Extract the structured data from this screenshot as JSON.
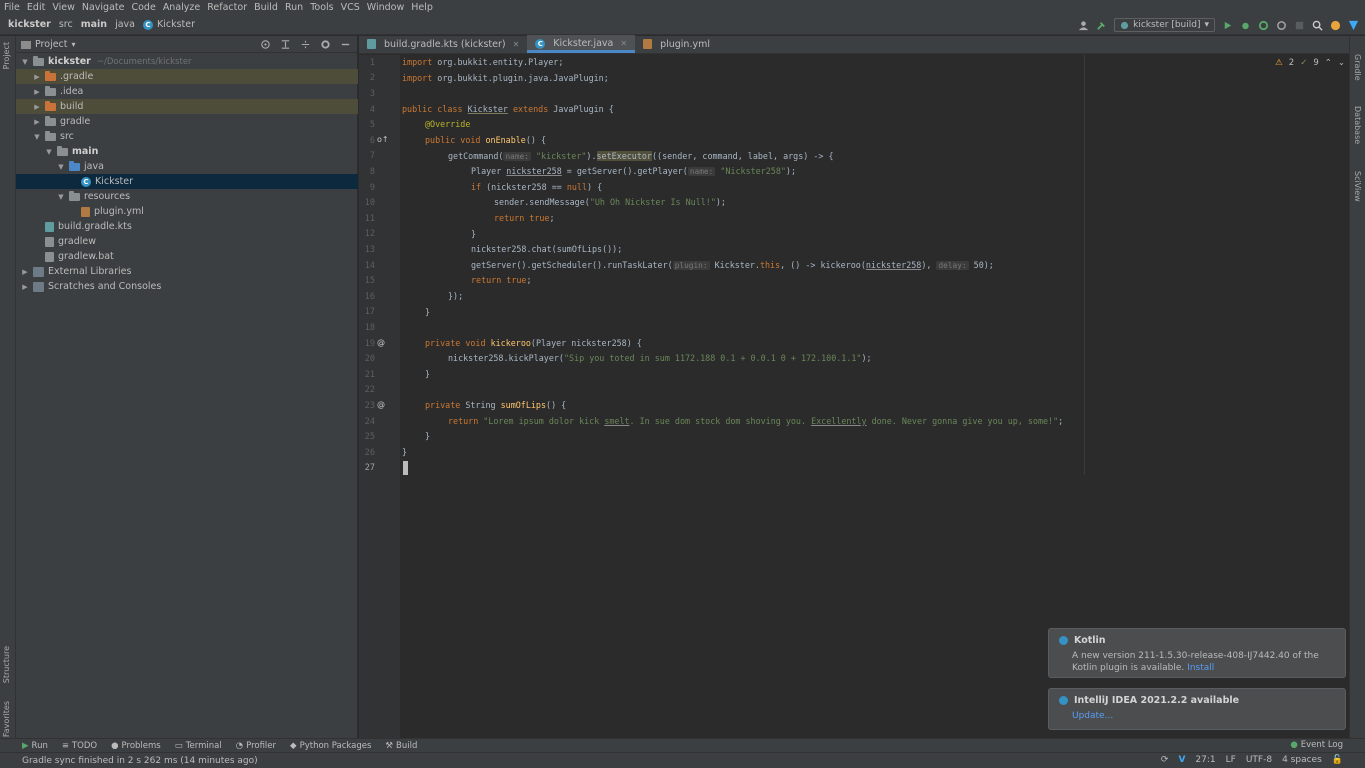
{
  "menu": [
    "File",
    "Edit",
    "View",
    "Navigate",
    "Code",
    "Analyze",
    "Refactor",
    "Build",
    "Run",
    "Tools",
    "VCS",
    "Window",
    "Help"
  ],
  "breadcrumbs": [
    "kickster",
    "src",
    "main",
    "java",
    "Kickster"
  ],
  "run_config": "kickster [build]",
  "project_panel": {
    "title": "Project",
    "root_path": "~/Documents/kickster",
    "items": [
      {
        "label": "kickster",
        "depth": 0,
        "open": true,
        "kind": "folder",
        "bold": true,
        "highlight": false
      },
      {
        "label": ".gradle",
        "depth": 1,
        "open": false,
        "kind": "folder-orange",
        "highlight": true
      },
      {
        "label": ".idea",
        "depth": 1,
        "open": false,
        "kind": "folder",
        "highlight": false
      },
      {
        "label": "build",
        "depth": 1,
        "open": false,
        "kind": "folder-orange",
        "highlight": true
      },
      {
        "label": "gradle",
        "depth": 1,
        "open": false,
        "kind": "folder",
        "highlight": false
      },
      {
        "label": "src",
        "depth": 1,
        "open": true,
        "kind": "folder",
        "highlight": false
      },
      {
        "label": "main",
        "depth": 2,
        "open": true,
        "kind": "folder",
        "bold": true,
        "highlight": false
      },
      {
        "label": "java",
        "depth": 3,
        "open": true,
        "kind": "folder-blue",
        "highlight": false
      },
      {
        "label": "Kickster",
        "depth": 4,
        "open": null,
        "kind": "class",
        "selected": true
      },
      {
        "label": "resources",
        "depth": 3,
        "open": true,
        "kind": "folder",
        "highlight": false
      },
      {
        "label": "plugin.yml",
        "depth": 4,
        "open": null,
        "kind": "yml"
      },
      {
        "label": "build.gradle.kts",
        "depth": 1,
        "open": null,
        "kind": "kts"
      },
      {
        "label": "gradlew",
        "depth": 1,
        "open": null,
        "kind": "file"
      },
      {
        "label": "gradlew.bat",
        "depth": 1,
        "open": null,
        "kind": "file"
      },
      {
        "label": "External Libraries",
        "depth": 0,
        "open": false,
        "kind": "lib"
      },
      {
        "label": "Scratches and Consoles",
        "depth": 0,
        "open": false,
        "kind": "scratch"
      }
    ]
  },
  "tabs": [
    {
      "label": "build.gradle.kts (kickster)",
      "active": false
    },
    {
      "label": "Kickster.java",
      "active": true
    },
    {
      "label": "plugin.yml",
      "active": false
    }
  ],
  "inspection": {
    "warnings": "2",
    "weak_warnings": "9"
  },
  "line_numbers": [
    "1",
    "2",
    "3",
    "4",
    "5",
    "6",
    "7",
    "8",
    "9",
    "10",
    "11",
    "12",
    "13",
    "14",
    "15",
    "16",
    "17",
    "18",
    "19",
    "20",
    "21",
    "22",
    "23",
    "24",
    "25",
    "26",
    "27"
  ],
  "code": {
    "l1a": "import",
    "l1b": " org.bukkit.entity.Player;",
    "l2a": "import",
    "l2b": " org.bukkit.plugin.java.JavaPlugin;",
    "l4a": "public class ",
    "l4b": "Kickster",
    "l4c": " extends",
    "l4d": " JavaPlugin {",
    "l5": "@Override",
    "l6a": "public void ",
    "l6b": "onEnable",
    "l6c": "() {",
    "l7a": "getCommand(",
    "l7h": "name:",
    "l7s": " \"kickster\"",
    "l7b": ").",
    "l7c": "setExecutor",
    "l7d": "((sender, command, label, args) -> {",
    "l8a": "Player ",
    "l8b": "nickster258",
    "l8c": " = getServer().getPlayer(",
    "l8h": "name:",
    "l8s": " \"Nickster258\"",
    "l8d": ");",
    "l9a": "if ",
    "l9b": "(nickster258 == ",
    "l9c": "null",
    "l9d": ") {",
    "l10a": "sender.sendMessage(",
    "l10s": "\"Uh Oh Nickster Is Null!\"",
    "l10b": ");",
    "l11a": "return ",
    "l11b": "true",
    "l11c": ";",
    "l12": "}",
    "l13a": "nickster258.chat(sumOfLips());",
    "l14a": "getServer().getScheduler().runTaskLater(",
    "l14h": "plugin:",
    "l14b": " Kickster.",
    "l14c": "this",
    "l14d": ", () -> kickeroo(",
    "l14e": "nickster258",
    "l14f": "), ",
    "l14h2": "delay:",
    "l14g": " 50);",
    "l15a": "return ",
    "l15b": "true",
    "l15c": ";",
    "l16": "});",
    "l17": "}",
    "l19a": "private void ",
    "l19b": "kickeroo",
    "l19c": "(Player nickster258) {",
    "l20a": "nickster258.kickPlayer(",
    "l20s": "\"Sip you toted in sum 1172.188 0.1 + 0.0.1 0 + 172.100.1.1\"",
    "l20b": ");",
    "l21": "}",
    "l23a": "private ",
    "l23b": "String ",
    "l23c": "sumOfLips",
    "l23d": "() {",
    "l24a": "return ",
    "l24s": "\"Lorem ipsum dolor kick ",
    "l24u": "smelt",
    "l24t": ". In sue dom stock dom shoving you. ",
    "l24v": "Excellently",
    "l24w": " done. Never gonna give you up, some!\"",
    "l24b": ";",
    "l25": "}",
    "l26": "}"
  },
  "notifications": [
    {
      "title": "Kotlin",
      "body": "A new version 211-1.5.30-release-408-IJ7442.40 of the Kotlin plugin is available.",
      "action": "Install"
    },
    {
      "title": "IntelliJ IDEA 2021.2.2 available",
      "body": "",
      "action": "Update..."
    }
  ],
  "bottom_tools": [
    "Run",
    "TODO",
    "Problems",
    "Terminal",
    "Profiler",
    "Python Packages",
    "Build"
  ],
  "event_log": "Event Log",
  "status_message": "Gradle sync finished in 2 s 262 ms (14 minutes ago)",
  "status": {
    "position": "27:1",
    "line_sep": "LF",
    "encoding": "UTF-8",
    "indent": "4 spaces"
  },
  "left_strip": [
    "Project",
    "Structure",
    "Favorites"
  ],
  "right_strip": [
    "Gradle",
    "Database",
    "SciView"
  ],
  "colors": {
    "accent": "#4a88c7",
    "keyword": "#cc7832",
    "string": "#6a8759",
    "function": "#ffc66d",
    "annotation": "#bbb529",
    "background": "#2b2b2b",
    "panel": "#3c3f41"
  }
}
